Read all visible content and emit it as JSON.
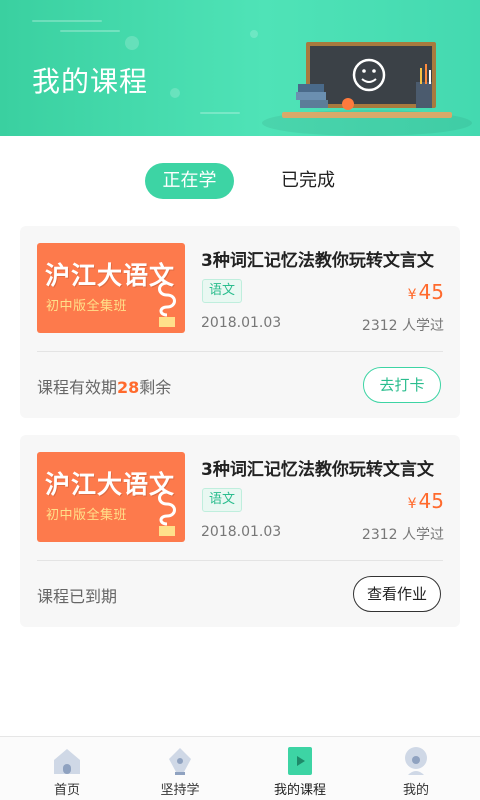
{
  "header": {
    "title": "我的课程"
  },
  "tabs": [
    {
      "label": "正在学",
      "active": true
    },
    {
      "label": "已完成",
      "active": false
    }
  ],
  "courses": [
    {
      "thumb_title": "沪江大语文",
      "thumb_subtitle": "初中版全集班",
      "title": "3种词汇记忆法教你玩转文言文",
      "tag": "语文",
      "currency": "¥",
      "price": "45",
      "date": "2018.01.03",
      "learners": "2312 人学过",
      "status_prefix": "课程有效期",
      "status_value": "28",
      "status_suffix": "剩余",
      "button": "去打卡"
    },
    {
      "thumb_title": "沪江大语文",
      "thumb_subtitle": "初中版全集班",
      "title": "3种词汇记忆法教你玩转文言文",
      "tag": "语文",
      "currency": "¥",
      "price": "45",
      "date": "2018.01.03",
      "learners": "2312 人学过",
      "status": "课程已到期",
      "button": "查看作业"
    }
  ],
  "nav": [
    {
      "label": "首页",
      "icon": "home-icon"
    },
    {
      "label": "坚持学",
      "icon": "pen-nib-icon"
    },
    {
      "label": "我的课程",
      "icon": "play-book-icon",
      "active": true
    },
    {
      "label": "我的",
      "icon": "profile-icon"
    }
  ],
  "colors": {
    "accent": "#3dd4a4",
    "price": "#ff6a2d",
    "thumb": "#fd7a4c"
  }
}
